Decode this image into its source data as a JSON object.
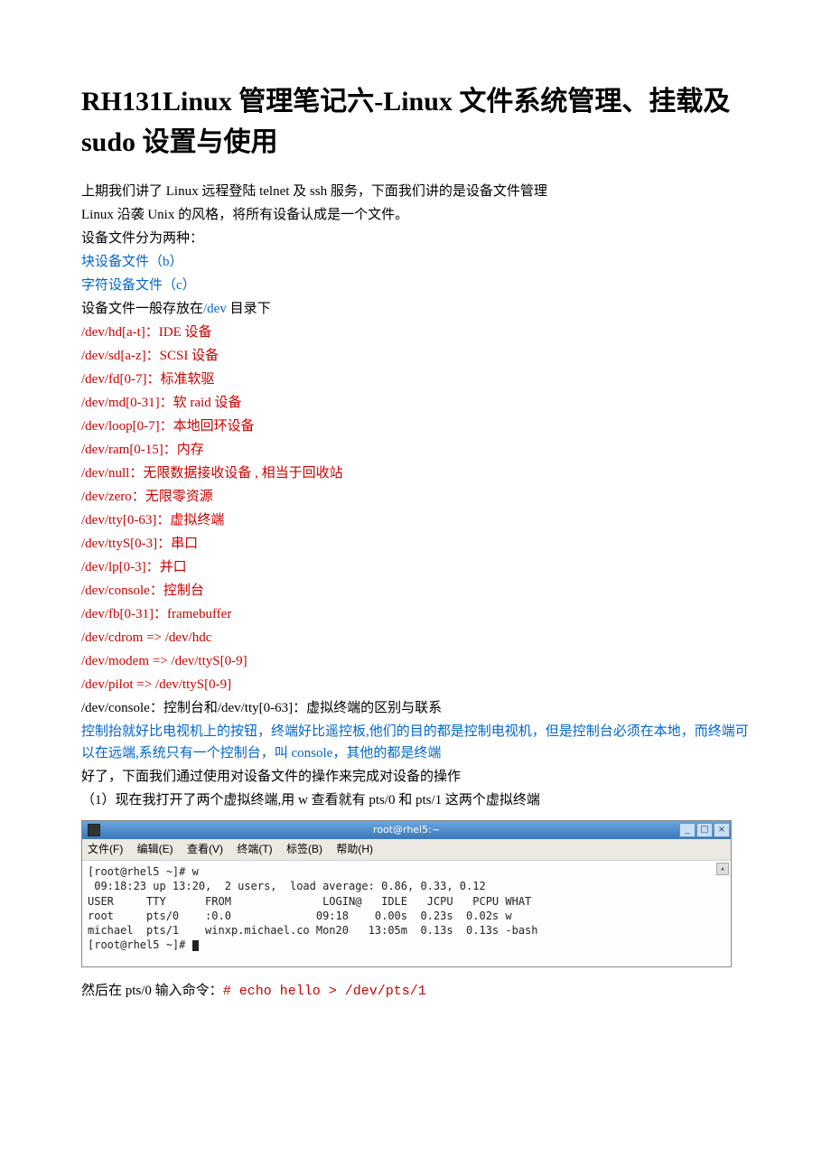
{
  "title": "RH131Linux 管理笔记六-Linux 文件系统管理、挂载及 sudo 设置与使用",
  "intro1": "上期我们讲了 Linux 远程登陆 telnet 及 ssh 服务，下面我们讲的是设备文件管理",
  "intro2": "Linux 沿袭 Unix 的风格，将所有设备认成是一个文件。",
  "intro3": "设备文件分为两种：",
  "type_b": "块设备文件（b）",
  "type_c": "字符设备文件（c）",
  "dev_label_pre": "设备文件一般存放在",
  "dev_path": "/dev",
  "dev_label_post": " 目录下",
  "dev": {
    "hd": "/dev/hd[a-t]：IDE 设备",
    "sd": "/dev/sd[a-z]：SCSI 设备",
    "fd": "/dev/fd[0-7]：标准软驱",
    "md": "/dev/md[0-31]：软 raid 设备",
    "loop": "/dev/loop[0-7]：本地回环设备",
    "ram": "/dev/ram[0-15]：内存",
    "null": "/dev/null：无限数据接收设备 , 相当于回收站",
    "zero": "/dev/zero：无限零资源",
    "tty": "/dev/tty[0-63]：虚拟终端",
    "ttyS": "/dev/ttyS[0-3]：串口",
    "lp": "/dev/lp[0-3]：并口",
    "console": "/dev/console：控制台",
    "fb": "/dev/fb[0-31]：framebuffer",
    "cdrom": "/dev/cdrom  => /dev/hdc",
    "modem": "/dev/modem => /dev/ttyS[0-9]",
    "pilot": "/dev/pilot => /dev/ttyS[0-9]"
  },
  "diff_line": "/dev/console：控制台和/dev/tty[0-63]：虚拟终端的区别与联系",
  "explain1": "控制抬就好比电视机上的按钮，终端好比遥控板,他们的目的都是控制电视机，但是控制台必须在本地，而终端可以在远端,系统只有一个控制台，叫 console，其他的都是终端",
  "ok_line": "好了，下面我们通过使用对设备文件的操作来完成对设备的操作",
  "step1": "（1）现在我打开了两个虚拟终端,用 w 查看就有 pts/0 和 pts/1 这两个虚拟终端",
  "terminal": {
    "title": "root@rhel5:~",
    "menu": {
      "file": "文件(F)",
      "edit": "编辑(E)",
      "view": "查看(V)",
      "term": "终端(T)",
      "tabs": "标签(B)",
      "help": "帮助(H)"
    },
    "win": {
      "min": "_",
      "max": "□",
      "close": "×"
    },
    "body": "[root@rhel5 ~]# w\n 09:18:23 up 13:20,  2 users,  load average: 0.86, 0.33, 0.12\nUSER     TTY      FROM              LOGIN@   IDLE   JCPU   PCPU WHAT\nroot     pts/0    :0.0             09:18    0.00s  0.23s  0.02s w\nmichael  pts/1    winxp.michael.co Mon20   13:05m  0.13s  0.13s -bash\n[root@rhel5 ~]# "
  },
  "after_term_pre": "然后在 pts/0 输入命令：",
  "after_term_cmd": "# echo hello  > /dev/pts/1"
}
